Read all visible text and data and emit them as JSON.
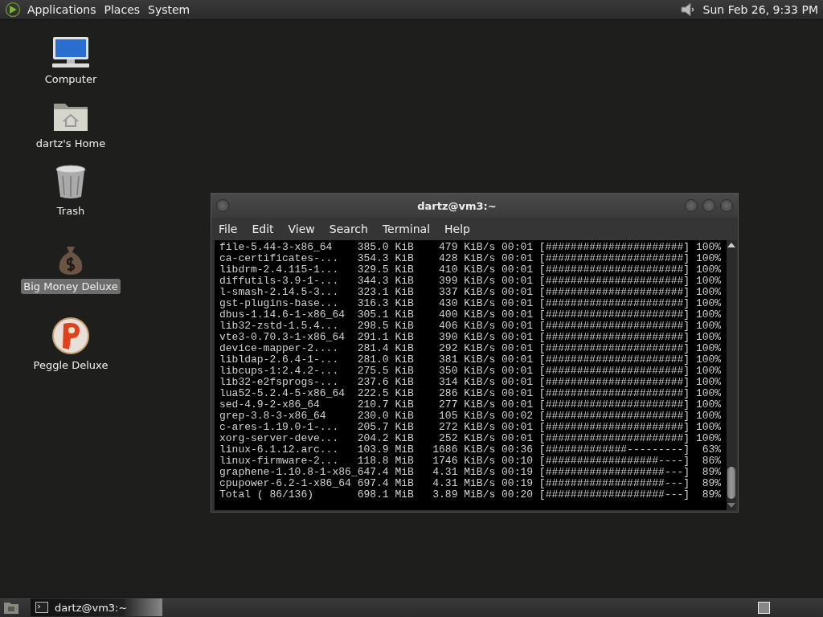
{
  "top_panel": {
    "menus": [
      "Applications",
      "Places",
      "System"
    ],
    "clock": "Sun Feb 26, 9:33 PM"
  },
  "desktop_icons": [
    {
      "label": "Computer",
      "kind": "computer",
      "selected": false
    },
    {
      "label": "dartz's Home",
      "kind": "home",
      "selected": false
    },
    {
      "label": "Trash",
      "kind": "trash",
      "selected": false
    },
    {
      "label": "Big Money Deluxe",
      "kind": "moneybag",
      "selected": true
    },
    {
      "label": "Peggle Deluxe",
      "kind": "ball",
      "selected": false
    }
  ],
  "terminal": {
    "title": "dartz@vm3:~",
    "menus": [
      "File",
      "Edit",
      "View",
      "Search",
      "Terminal",
      "Help"
    ],
    "lines": [
      "file-5.44-3-x86_64    385.0 KiB    479 KiB/s 00:01 [######################] 100%",
      "ca-certificates-...   354.3 KiB    428 KiB/s 00:01 [######################] 100%",
      "libdrm-2.4.115-1...   329.5 KiB    410 KiB/s 00:01 [######################] 100%",
      "diffutils-3.9-1-...   344.3 KiB    399 KiB/s 00:01 [######################] 100%",
      "l-smash-2.14.5-3...   323.1 KiB    337 KiB/s 00:01 [######################] 100%",
      "gst-plugins-base...   316.3 KiB    430 KiB/s 00:01 [######################] 100%",
      "dbus-1.14.6-1-x86_64  305.1 KiB    400 KiB/s 00:01 [######################] 100%",
      "lib32-zstd-1.5.4...   298.5 KiB    406 KiB/s 00:01 [######################] 100%",
      "vte3-0.70.3-1-x86_64  291.1 KiB    390 KiB/s 00:01 [######################] 100%",
      "device-mapper-2....   281.4 KiB    292 KiB/s 00:01 [######################] 100%",
      "libldap-2.6.4-1-...   281.0 KiB    381 KiB/s 00:01 [######################] 100%",
      "libcups-1:2.4.2-...   275.5 KiB    350 KiB/s 00:01 [######################] 100%",
      "lib32-e2fsprogs-...   237.6 KiB    314 KiB/s 00:01 [######################] 100%",
      "lua52-5.2.4-5-x86_64  222.5 KiB    286 KiB/s 00:01 [######################] 100%",
      "sed-4.9-2-x86_64      210.7 KiB    277 KiB/s 00:01 [######################] 100%",
      "grep-3.8-3-x86_64     230.0 KiB    105 KiB/s 00:02 [######################] 100%",
      "c-ares-1.19.0-1-...   205.7 KiB    272 KiB/s 00:01 [######################] 100%",
      "xorg-server-deve...   204.2 KiB    252 KiB/s 00:01 [######################] 100%",
      "linux-6.1.12.arc...   103.9 MiB   1686 KiB/s 00:36 [#############---------]  63%",
      "linux-firmware-2...   118.8 MiB   1746 KiB/s 00:10 [##################----]  86%",
      "graphene-1.10.8-1-x86_647.4 MiB   4.31 MiB/s 00:19 [###################---]  89%",
      "cpupower-6.2-1-x86_64 697.4 MiB   4.31 MiB/s 00:19 [###################---]  89%",
      "Total ( 86/136)       698.1 MiB   3.89 MiB/s 00:20 [###################---]  89%"
    ]
  },
  "taskbar": {
    "tasks": [
      {
        "label": "dartz@vm3:~",
        "selected": true
      }
    ]
  }
}
